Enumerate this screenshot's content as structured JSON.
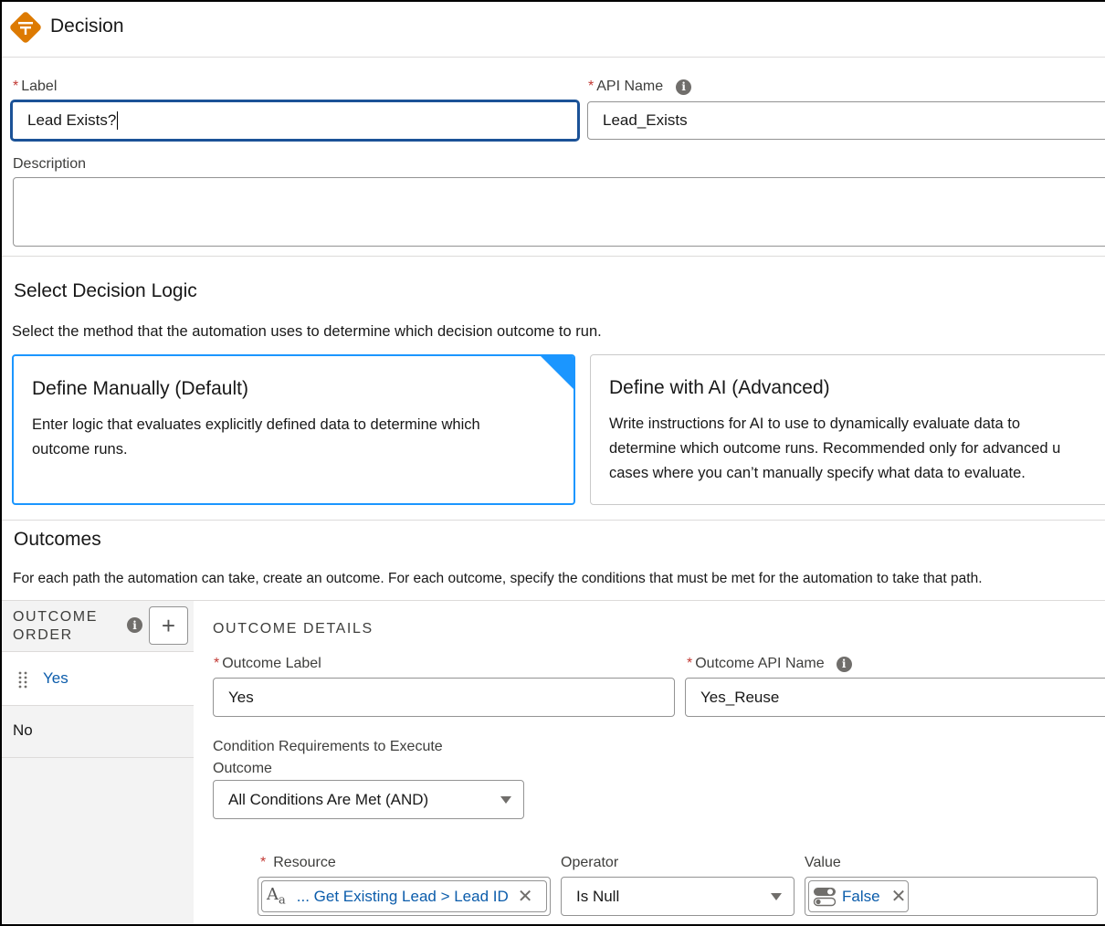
{
  "header": {
    "title": "Decision",
    "icon": "decision-icon",
    "icon_color": "#dd7a01"
  },
  "form": {
    "label": {
      "label": "Label",
      "value": "Lead Exists?",
      "required": "*"
    },
    "api_name": {
      "label": "API Name",
      "value": "Lead_Exists",
      "required": "*"
    },
    "description": {
      "label": "Description",
      "value": ""
    }
  },
  "decision_logic": {
    "title": "Select Decision Logic",
    "subtitle": "Select the method that the automation uses to determine which decision outcome to run.",
    "options": [
      {
        "title": "Define Manually (Default)",
        "desc_line1": "Enter logic that evaluates explicitly defined data to determine which",
        "desc_line2": "outcome runs.",
        "selected": true
      },
      {
        "title": "Define with AI (Advanced)",
        "desc_line1": "Write instructions for AI to use to dynamically evaluate data to",
        "desc_line2": "determine which outcome runs. Recommended only for advanced u",
        "desc_line3": "cases where you can’t manually specify what data to evaluate.",
        "selected": false
      }
    ]
  },
  "outcomes": {
    "title": "Outcomes",
    "subtitle": "For each path the automation can take, create an outcome. For each outcome, specify the conditions that must be met for the automation to take that path.",
    "order_header_line1": "OUTCOME",
    "order_header_line2": "ORDER",
    "add_button": "+",
    "items": [
      {
        "label": "Yes",
        "selected": true
      },
      {
        "label": "No",
        "selected": false
      }
    ],
    "details": {
      "header": "OUTCOME DETAILS",
      "outcome_label": {
        "label": "Outcome Label",
        "value": "Yes",
        "required": "*"
      },
      "outcome_api_name": {
        "label": "Outcome API Name",
        "value": "Yes_Reuse",
        "required": "*"
      },
      "condition_req_line1": "Condition Requirements to Execute",
      "condition_req_line2": "Outcome",
      "condition_req_value": "All Conditions Are Met (AND)",
      "condition_row": {
        "resource_label": "Resource",
        "resource_required": "*",
        "resource_value": "... Get Existing Lead > Lead ID",
        "operator_label": "Operator",
        "operator_value": "Is Null",
        "value_label": "Value",
        "value_value": "False"
      }
    }
  },
  "colors": {
    "accent": "#1b96ff",
    "link": "#0b5cab",
    "focus": "#1b5297",
    "required": "#c23934"
  }
}
